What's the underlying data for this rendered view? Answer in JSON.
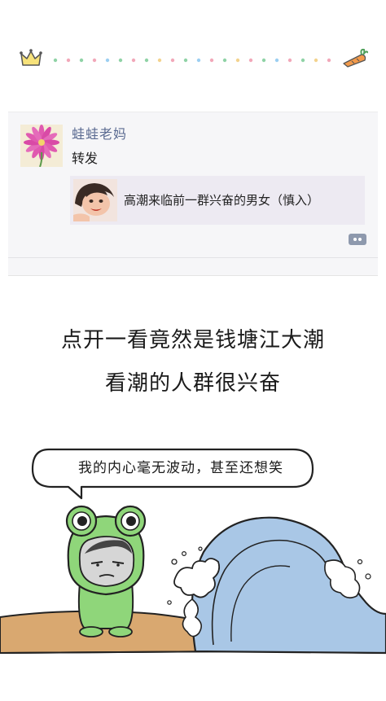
{
  "top_decoration": {
    "left_icon": "crown-icon",
    "right_icon": "carrot-icon",
    "dot_colors": [
      "#8fd3a6",
      "#f2a8b9",
      "#9ccff2",
      "#f3d38e"
    ]
  },
  "post": {
    "username": "蛙蛙老妈",
    "text": "转发",
    "link_title": "高潮来临前一群兴奋的男女（慎入）",
    "avatar_icon": "flower-icon",
    "thumb_icon": "face-photo-icon",
    "comment_icon": "comment-icon"
  },
  "headline": {
    "line1": "点开一看竟然是钱塘江大潮",
    "line2": "看潮的人群很兴奋"
  },
  "comic": {
    "speech": "我的内心毫无波动，甚至还想笑",
    "character": "frog-hood-character",
    "wave": "tidal-wave"
  }
}
